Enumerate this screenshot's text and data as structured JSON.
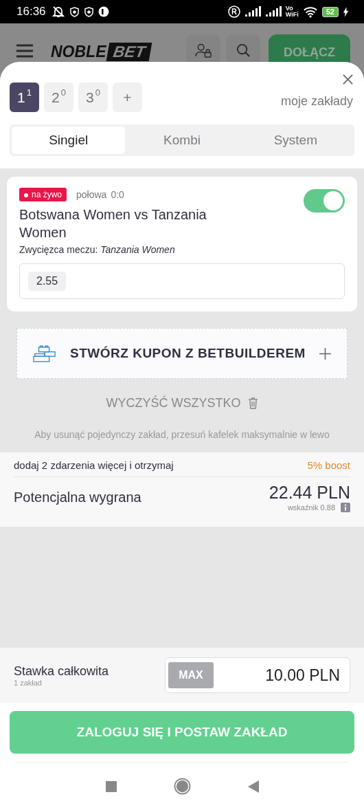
{
  "status_bar": {
    "time": "16:36",
    "volte": [
      "Vo",
      "WiFi"
    ],
    "battery": "52"
  },
  "header": {
    "logo": [
      "NOBLE",
      "BET"
    ],
    "join_button": "DOŁĄCZ"
  },
  "slip_tabs": [
    {
      "number": "1",
      "count": "1",
      "selected": true
    },
    {
      "number": "2",
      "count": "0",
      "selected": false
    },
    {
      "number": "3",
      "count": "0",
      "selected": false
    }
  ],
  "add_slip": "+",
  "my_bets_link": "moje zakłady",
  "bet_types": [
    {
      "label": "Singiel",
      "selected": true
    },
    {
      "label": "Kombi",
      "selected": false
    },
    {
      "label": "System",
      "selected": false
    }
  ],
  "selection": {
    "live_badge": "na żywo",
    "period": "połowa",
    "score": "0:0",
    "on": true,
    "event": "Botswana Women vs Tanzania Women",
    "market": "Zwycięzca meczu:",
    "pick": "Tanzania Women",
    "odds": "2.55"
  },
  "betbuilder_button": "STWÓRZ KUPON Z BETBUILDEREM",
  "clear_all": "WYCZYŚĆ WSZYSTKO",
  "hint": "Aby usunąć pojedynczy zakład, przesuń kafelek maksymalnie w lewo",
  "boost": {
    "text": "dodaj 2 zdarzenia więcej i otrzymaj",
    "value": "5% boost"
  },
  "potential_win": {
    "label": "Potencjalna wygrana",
    "amount": "22.44 PLN",
    "odds_label": "wskaźnik 0.88"
  },
  "stake": {
    "label": "Stawka całkowita",
    "sublabel": "1 zakład",
    "max_button": "MAX",
    "value": "10.00 PLN"
  },
  "submit_button": "ZALOGUJ SIĘ I POSTAW ZAKŁAD"
}
